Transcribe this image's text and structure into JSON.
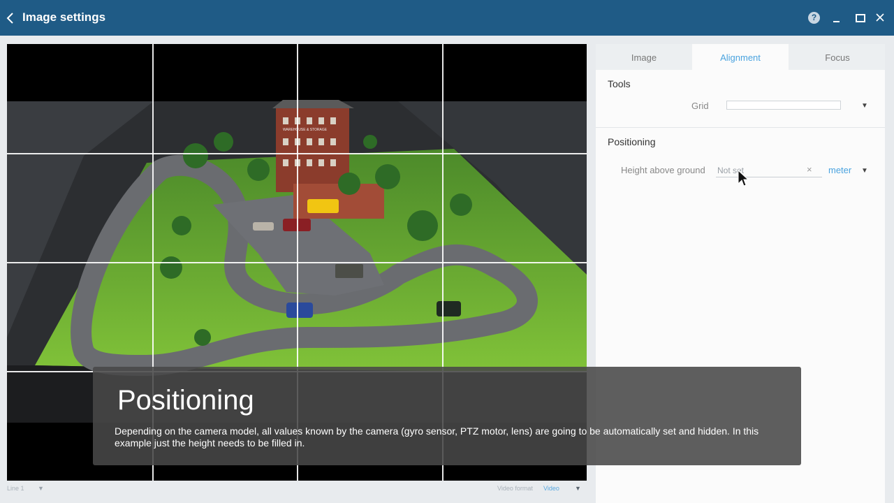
{
  "window": {
    "title": "Image settings",
    "help_label": "?"
  },
  "video": {
    "footer_left": "Line 1",
    "footer_right_label": "Video format",
    "footer_right_value": "Video",
    "scene_sign": "WAREHOUSE & STORAGE"
  },
  "panel": {
    "tabs": [
      {
        "label": "Image",
        "active": false
      },
      {
        "label": "Alignment",
        "active": true
      },
      {
        "label": "Focus",
        "active": false
      }
    ],
    "tools": {
      "heading": "Tools",
      "grid_label": "Grid",
      "grid_value": ""
    },
    "positioning": {
      "heading": "Positioning",
      "height_label": "Height above ground",
      "height_placeholder": "Not set",
      "clear_symbol": "×",
      "unit": "meter"
    }
  },
  "caption": {
    "title": "Positioning",
    "body": "Depending on the camera model, all values known by the camera (gyro sensor, PTZ  motor, lens) are going to be automatically set and hidden. In this example  just the height needs to be filled in."
  },
  "colors": {
    "titlebar": "#1f5b86",
    "accent": "#4aa3df",
    "caption_bg": "#484848"
  }
}
